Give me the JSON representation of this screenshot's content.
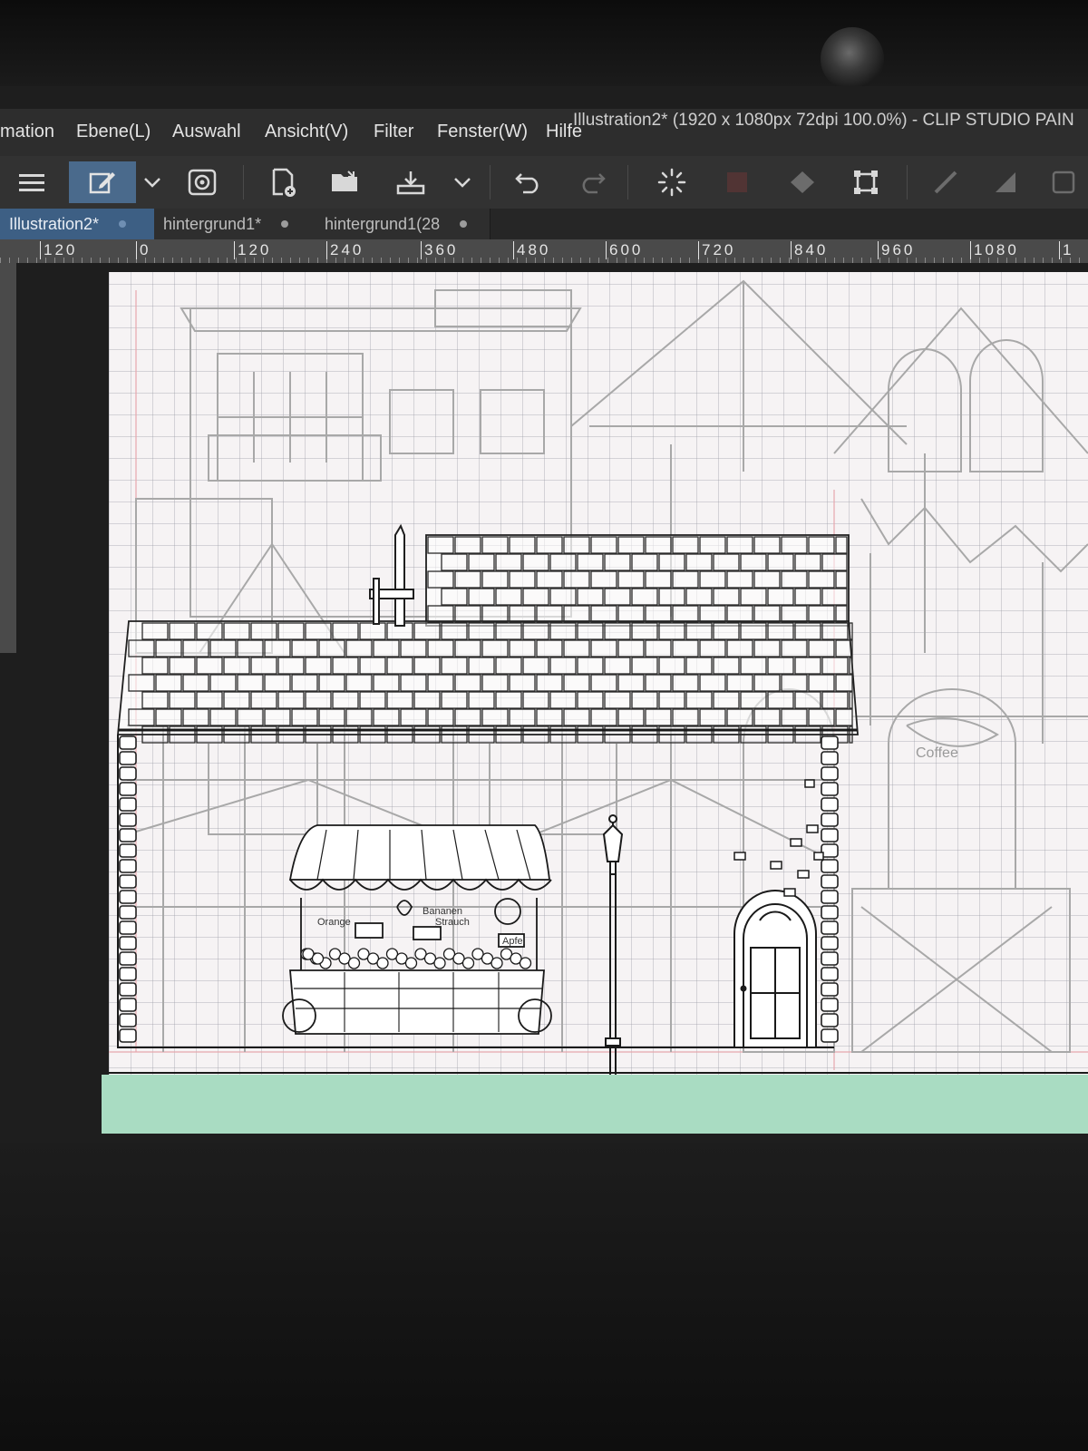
{
  "window": {
    "title": "Illustration2* (1920 x 1080px 72dpi 100.0%) - CLIP STUDIO PAIN"
  },
  "menu": {
    "items": [
      "mation",
      "Ebene(L)",
      "Auswahl",
      "Ansicht(V)",
      "Filter",
      "Fenster(W)",
      "Hilfe"
    ]
  },
  "toolbar": {
    "icons": [
      "menu-icon",
      "edit-pen-icon",
      "chevron-down-icon",
      "spiral-icon",
      "new-file-icon",
      "open-folder-icon",
      "save-icon",
      "chevron-down-icon",
      "undo-icon",
      "redo-icon",
      "loading-icon",
      "layer-icon",
      "fill-icon",
      "transform-icon",
      "tool-icon",
      "tool-icon",
      "tool-icon"
    ]
  },
  "tabs": [
    {
      "label": "Illustration2*",
      "active": true
    },
    {
      "label": "hintergrund1*",
      "active": false
    },
    {
      "label": "hintergrund1(28",
      "active": false
    }
  ],
  "ruler": {
    "labels": [
      "120",
      "0",
      "120",
      "240",
      "360",
      "480",
      "600",
      "720",
      "840",
      "960",
      "1080",
      "1"
    ]
  },
  "canvas": {
    "cart_labels": [
      "Orange",
      "Bananen",
      "Strauch",
      "Apfel"
    ],
    "sign_label": "Coffee"
  },
  "colors": {
    "menubar": "#2d2d2d",
    "active_tab": "#3d5f84",
    "canvas": "#f6f3f4",
    "grass": "#a9dcc2"
  }
}
